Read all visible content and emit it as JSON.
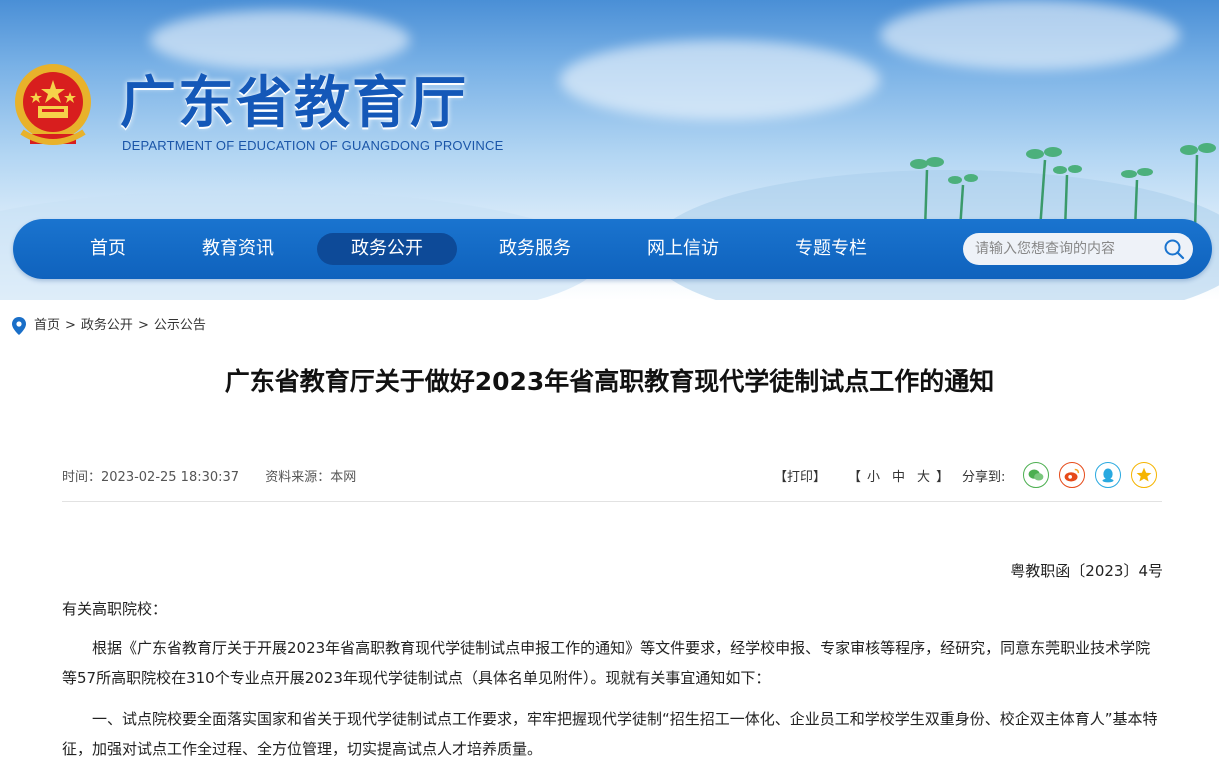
{
  "header": {
    "title": "广东省教育厅",
    "subtitle": "DEPARTMENT OF EDUCATION OF GUANGDONG PROVINCE"
  },
  "nav": {
    "items": [
      {
        "label": "首页"
      },
      {
        "label": "教育资讯"
      },
      {
        "label": "政务公开"
      },
      {
        "label": "政务服务"
      },
      {
        "label": "网上信访"
      },
      {
        "label": "专题专栏"
      }
    ],
    "active_index": 2,
    "search_placeholder": "请输入您想查询的内容"
  },
  "breadcrumb": {
    "items": [
      "首页",
      "政务公开",
      "公示公告"
    ],
    "separator": ">"
  },
  "article": {
    "title": "广东省教育厅关于做好2023年省高职教育现代学徒制试点工作的通知",
    "time": "时间：2023-02-25 18:30:37",
    "source": "资料来源：本网",
    "print_label": "【打印】",
    "font_size": {
      "open": "【",
      "small": "小",
      "medium": "中",
      "large": "大",
      "close": "】"
    },
    "share_label": "分享到:",
    "share_icons": [
      "wechat-icon",
      "weibo-icon",
      "qq-icon",
      "qzone-icon"
    ],
    "doc_number": "粤教职函〔2023〕4号",
    "salutation": "有关高职院校：",
    "paragraphs": [
      "根据《广东省教育厅关于开展2023年省高职教育现代学徒制试点申报工作的通知》等文件要求，经学校申报、专家审核等程序，经研究，同意东莞职业技术学院等57所高职院校在310个专业点开展2023年现代学徒制试点（具体名单见附件）。现就有关事宜通知如下：",
      "一、试点院校要全面落实国家和省关于现代学徒制试点工作要求，牢牢把握现代学徒制“招生招工一体化、企业员工和学校学生双重身份、校企双主体育人”基本特征，加强对试点工作全过程、全方位管理，切实提高试点人才培养质量。"
    ]
  },
  "colors": {
    "brand_blue": "#1458b8",
    "nav_bg": "#1a74cf",
    "nav_active": "#0d4a98",
    "wechat": "#4caf50",
    "weibo": "#e64a19",
    "qq": "#29a9e0",
    "qzone": "#f5b400"
  }
}
